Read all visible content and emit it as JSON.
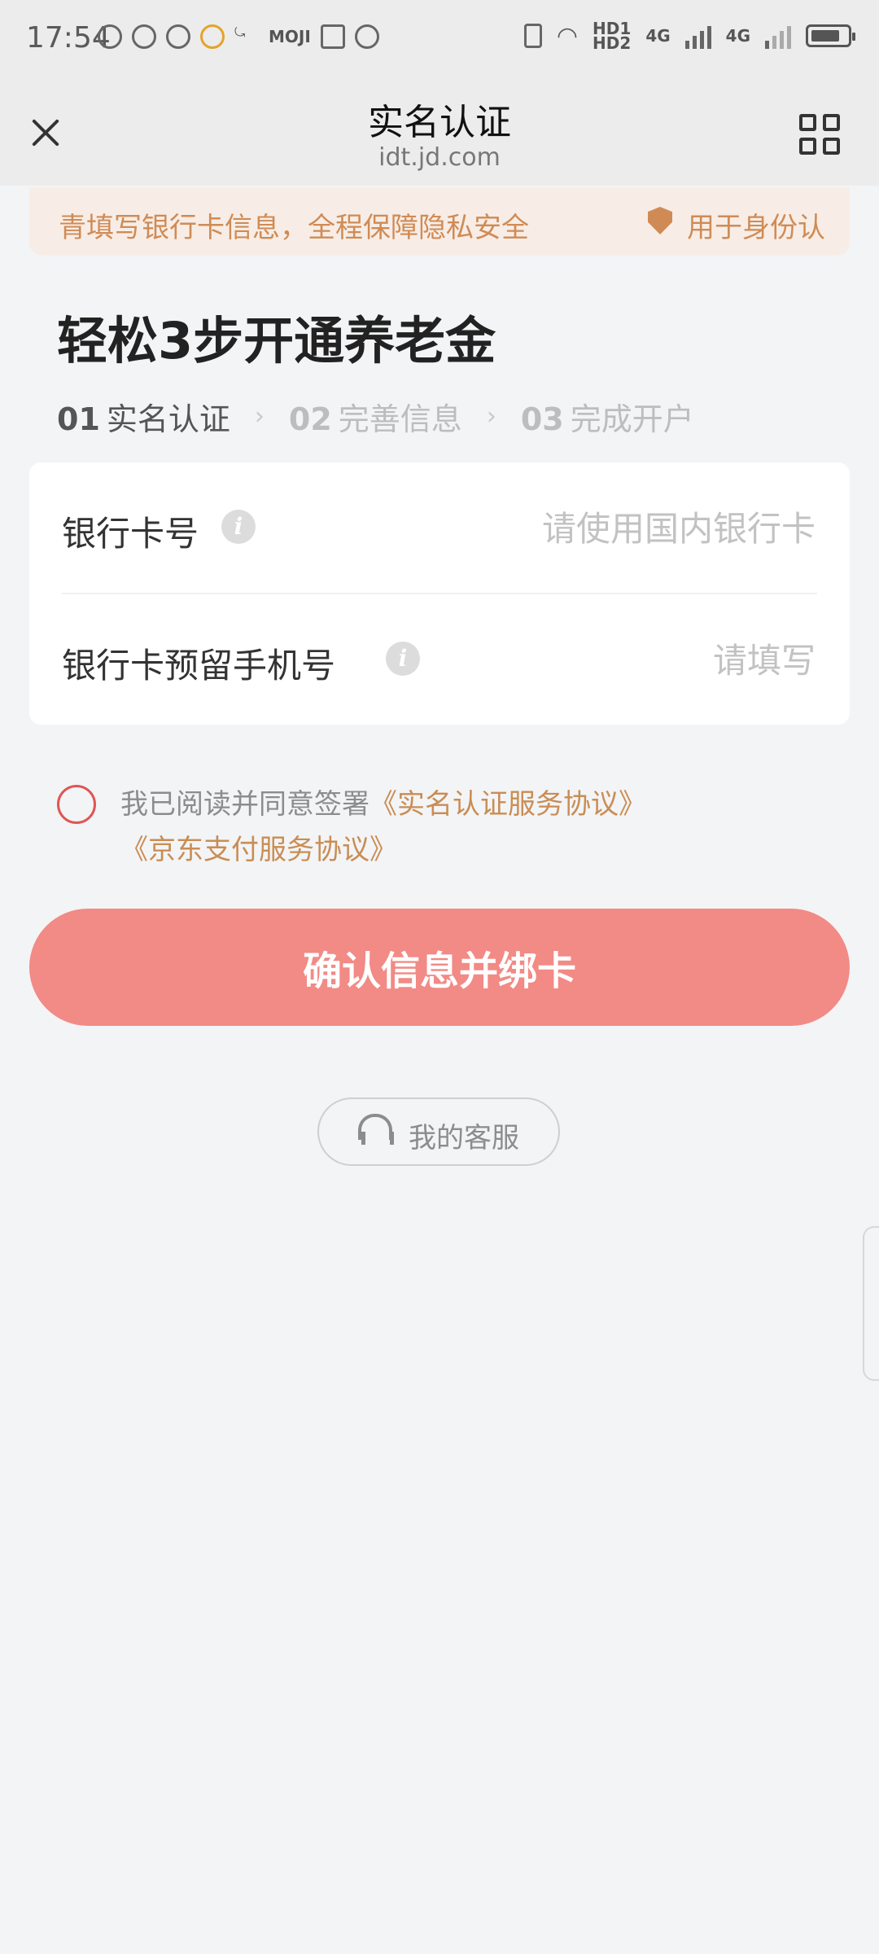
{
  "status_bar": {
    "time": "17:54",
    "moji": "MOJI",
    "hd": "HD1\nHD2",
    "net1": "4G",
    "net2": "4G"
  },
  "nav": {
    "title": "实名认证",
    "domain": "idt.jd.com"
  },
  "notice": {
    "left_text": "青填写银行卡信息，全程保障隐私安全",
    "right_text": "用于身份认"
  },
  "headline": "轻松3步开通养老金",
  "steps": [
    {
      "num": "01",
      "label": "实名认证"
    },
    {
      "num": "02",
      "label": "完善信息"
    },
    {
      "num": "03",
      "label": "完成开户"
    }
  ],
  "form": {
    "bank_card": {
      "label": "银行卡号",
      "placeholder": "请使用国内银行卡",
      "value": ""
    },
    "phone": {
      "label": "银行卡预留手机号",
      "placeholder": "请填写",
      "value": ""
    }
  },
  "agreement": {
    "prefix": "我已阅读并同意签署",
    "link1": "《实名认证服务协议》",
    "link2": "《京东支付服务协议》"
  },
  "confirm_button": "确认信息并绑卡",
  "service_button": "我的客服",
  "colors": {
    "accent": "#f28a85",
    "link": "#c98d54",
    "radio": "#e05555"
  }
}
